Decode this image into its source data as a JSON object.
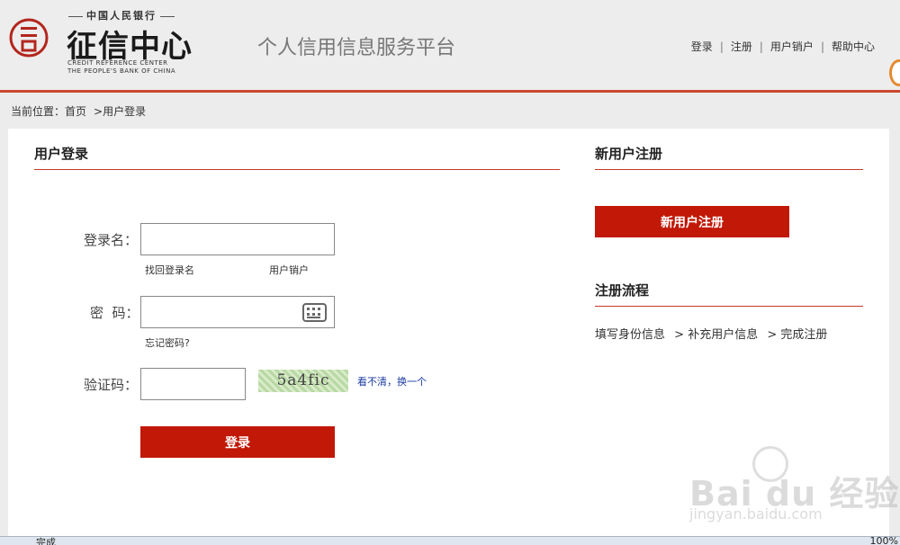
{
  "header": {
    "logo_top": "中国人民银行",
    "logo_main": "征信中心",
    "logo_en_line1": "CREDIT REFERENCE CENTER",
    "logo_en_line2": "THE PEOPLE'S BANK OF CHINA",
    "platform_title": "个人信用信息服务平台",
    "nav": [
      "登录",
      "注册",
      "用户销户",
      "帮助中心"
    ],
    "nav_separator": "|"
  },
  "breadcrumb": {
    "prefix": "当前位置：",
    "home": "首页",
    "separator": ">",
    "current": "用户登录"
  },
  "login": {
    "title": "用户登录",
    "username_label": "登录名：",
    "username_value": "",
    "find_username_link": "找回登录名",
    "cancel_account_link": "用户销户",
    "password_label": "密  码：",
    "password_value": "",
    "forgot_password_link": "忘记密码?",
    "captcha_label": "验证码：",
    "captcha_value": "",
    "captcha_text": "5a4fic",
    "refresh_captcha_link": "看不清，换一个",
    "login_button": "登录"
  },
  "register": {
    "title": "新用户注册",
    "button": "新用户注册",
    "process_title": "注册流程",
    "steps": [
      "填写身份信息",
      "补充用户信息",
      "完成注册"
    ],
    "step_separator": ">"
  },
  "watermark": {
    "main": "Bai du 经验",
    "sub": "jingyan.baidu.com"
  },
  "statusbar": {
    "status": "完成",
    "zoom": "100%"
  },
  "colors": {
    "accent_red": "#c21807",
    "header_line": "#c9482f",
    "link_blue": "#1a3aa0"
  }
}
